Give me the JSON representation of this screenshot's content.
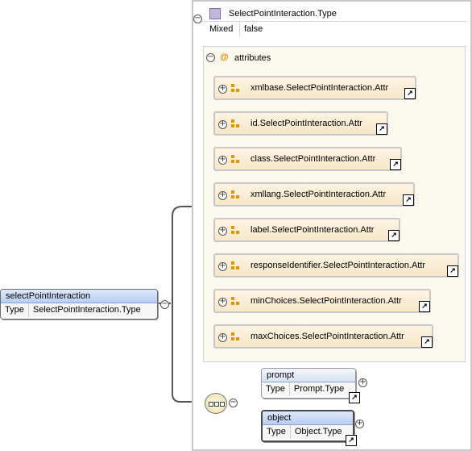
{
  "root_element": {
    "name": "selectPointInteraction",
    "type_key": "Type",
    "type_value": "SelectPointInteraction.Type"
  },
  "complex_type": {
    "title": "SelectPointInteraction.Type",
    "mixed_key": "Mixed",
    "mixed_value": "false"
  },
  "attributes_group": {
    "label": "attributes",
    "icon": "@",
    "items": [
      {
        "label": "xmlbase.SelectPointInteraction.Attr"
      },
      {
        "label": "id.SelectPointInteraction.Attr"
      },
      {
        "label": "class.SelectPointInteraction.Attr"
      },
      {
        "label": "xmllang.SelectPointInteraction.Attr"
      },
      {
        "label": "label.SelectPointInteraction.Attr"
      },
      {
        "label": "responseIdentifier.SelectPointInteraction.Attr"
      },
      {
        "label": "minChoices.SelectPointInteraction.Attr"
      },
      {
        "label": "maxChoices.SelectPointInteraction.Attr"
      }
    ]
  },
  "children": [
    {
      "name": "prompt",
      "type_key": "Type",
      "type_value": "Prompt.Type",
      "optional": true
    },
    {
      "name": "object",
      "type_key": "Type",
      "type_value": "Object.Type",
      "optional": false
    }
  ],
  "colors": {
    "attribute_fill": "#f6e7c8",
    "element_header": "#b9cdf2",
    "type_icon": "#c3b6dc",
    "attribute_icon": "#e59400"
  }
}
